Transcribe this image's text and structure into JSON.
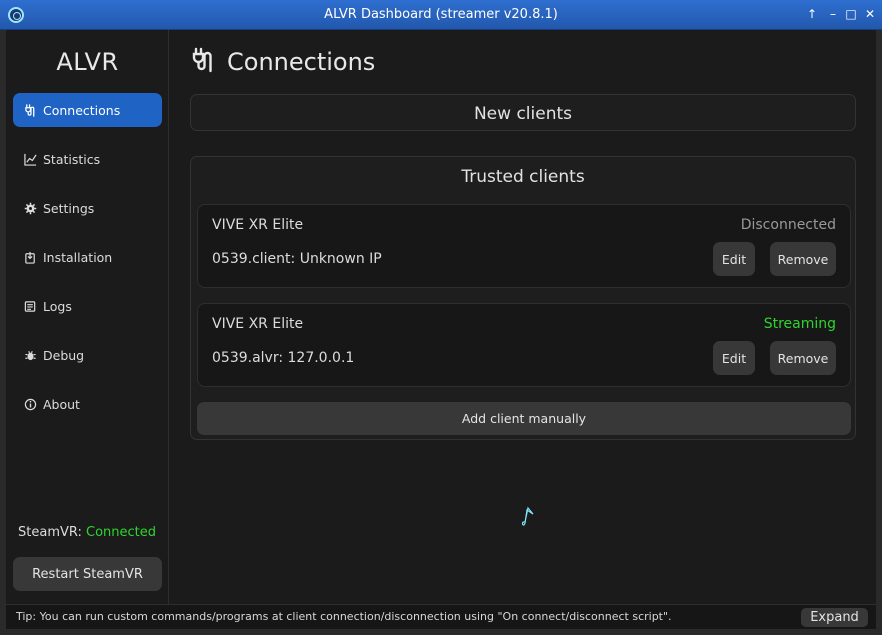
{
  "window": {
    "title": "ALVR Dashboard (streamer v20.8.1)",
    "controls": [
      "pin-icon",
      "minimize-icon",
      "maximize-icon",
      "close-icon"
    ]
  },
  "sidebar": {
    "brand": "ALVR",
    "items": [
      {
        "label": "Connections",
        "icon": "plug-icon",
        "active": true
      },
      {
        "label": "Statistics",
        "icon": "chart-icon",
        "active": false
      },
      {
        "label": "Settings",
        "icon": "gear-icon",
        "active": false
      },
      {
        "label": "Installation",
        "icon": "install-icon",
        "active": false
      },
      {
        "label": "Logs",
        "icon": "logs-icon",
        "active": false
      },
      {
        "label": "Debug",
        "icon": "bug-icon",
        "active": false
      },
      {
        "label": "About",
        "icon": "info-icon",
        "active": false
      }
    ],
    "steamvr_label": "SteamVR:",
    "steamvr_status": "Connected",
    "restart_label": "Restart SteamVR"
  },
  "main": {
    "title": "Connections",
    "new_clients_title": "New clients",
    "trusted_clients_title": "Trusted clients",
    "clients": [
      {
        "name": "VIVE XR Elite",
        "status": "Disconnected",
        "address": "0539.client: Unknown IP",
        "edit_label": "Edit",
        "remove_label": "Remove"
      },
      {
        "name": "VIVE XR Elite",
        "status": "Streaming",
        "address": "0539.alvr: 127.0.0.1",
        "edit_label": "Edit",
        "remove_label": "Remove"
      }
    ],
    "add_client_label": "Add client manually"
  },
  "footer": {
    "tip": "Tip: You can run custom commands/programs at client connection/disconnection using \"On connect/disconnect script\".",
    "expand_label": "Expand"
  },
  "colors": {
    "accent": "#1f63c4",
    "connected": "#2fd52f",
    "disconnected": "#9a9a9a",
    "titlebar": "#2660bd"
  }
}
